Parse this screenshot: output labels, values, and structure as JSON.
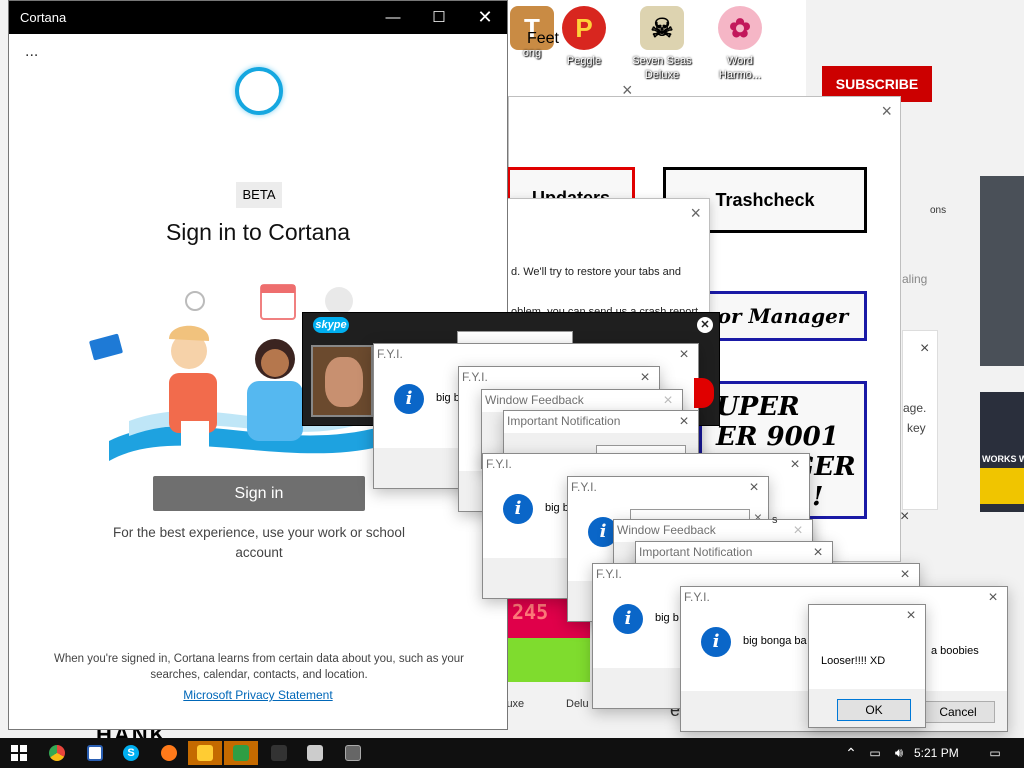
{
  "desktop": {
    "icons": [
      {
        "label": "Feet",
        "sub": "ong",
        "glyph": "T",
        "color": "#c98b44"
      },
      {
        "label": "Peggle",
        "glyph": "P",
        "color": "#d8261f"
      },
      {
        "label": "Seven Seas Deluxe",
        "glyph": "☠",
        "color": "#ddd3b0"
      },
      {
        "label": "Word Harmo...",
        "glyph": "✿",
        "color": "#f5b6c6"
      }
    ],
    "subscribe_label": "SUBSCRIBE",
    "fragments": {
      "ons": "ons",
      "aling": "aling",
      "age": "age.",
      "key": "key",
      "works": "WORKS W",
      "luxe": "luxe",
      "delu": "Delu",
      "e_char": "e",
      "counter": "245",
      "hank": "HANK"
    }
  },
  "webpage": {
    "close": "×",
    "link_red": "Updaters",
    "link_trashcheck": "Trashcheck",
    "link_manager": "or Manager",
    "link_super": [
      "UPER",
      "ER 9001",
      "GER",
      "!"
    ],
    "restore_close": "×",
    "restore_line1": "d. We'll try to restore your tabs and",
    "restore_line2": "oblem, you can send us a crash report"
  },
  "cortana": {
    "title": "Cortana",
    "menu": "...",
    "beta": "BETA",
    "heading": "Sign in to Cortana",
    "signin_label": "Sign in",
    "best_experience": "For the best experience, use your work or school account",
    "learn": "When you're signed in, Cortana learns from certain data about you, such as your searches, calendar, contacts, and location.",
    "privacy": "Microsoft Privacy Statement"
  },
  "skype": {
    "logo": "skype"
  },
  "popups": {
    "fyi": "F.Y.I.",
    "window_feedback": "Window Feedback",
    "important": "Important Notification",
    "msg_short": "big b",
    "msg_long": "big bonga ba",
    "msg_tail": "a boobies",
    "loser": "Looser!!!! XD",
    "ok": "OK",
    "cancel": "Cancel",
    "close": "×",
    "info": "i",
    "s_char": "s"
  },
  "taskbar": {
    "time": "5:21 PM",
    "colors": {
      "start": "#ffffff",
      "chrome": "#e8453c",
      "skype": "#00aff0",
      "firefox": "#ff7a1a"
    }
  }
}
